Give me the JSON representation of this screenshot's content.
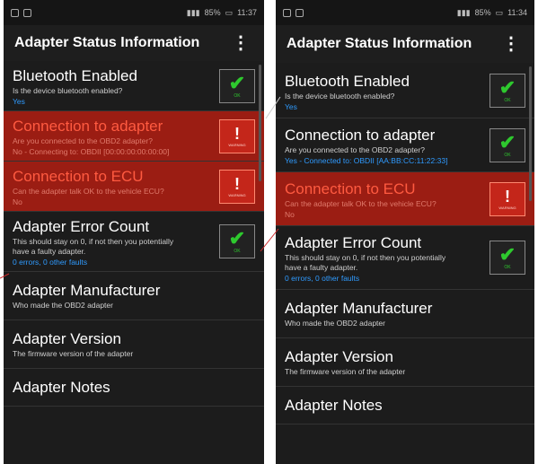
{
  "left": {
    "status_time": "11:37",
    "status_battery": "85%",
    "app_title": "Adapter Status Information",
    "menu_icon": "⋮",
    "items": [
      {
        "title": "Bluetooth Enabled",
        "desc": "Is the device bluetooth enabled?",
        "value": "Yes",
        "state": "ok"
      },
      {
        "title": "Connection to adapter",
        "desc": "Are you connected to the OBD2 adapter?",
        "value": "No - Connecting to: OBDII [00:00:00:00:00:00]",
        "state": "warn"
      },
      {
        "title": "Connection to ECU",
        "desc": "Can the adapter talk OK to the vehicle ECU?",
        "value": "No",
        "state": "warn"
      },
      {
        "title": "Adapter Error Count",
        "desc": "This should stay on 0, if not then you potentially have a faulty adapter.",
        "value": "0 errors, 0 other faults",
        "state": "ok"
      },
      {
        "title": "Adapter Manufacturer",
        "desc": "Who made the OBD2 adapter",
        "value": "",
        "state": "none"
      },
      {
        "title": "Adapter Version",
        "desc": "The firmware version of the adapter",
        "value": "",
        "state": "none"
      },
      {
        "title": "Adapter Notes",
        "desc": "",
        "value": "",
        "state": "none"
      }
    ]
  },
  "right": {
    "status_time": "11:34",
    "status_battery": "85%",
    "app_title": "Adapter Status Information",
    "menu_icon": "⋮",
    "items": [
      {
        "title": "Bluetooth Enabled",
        "desc": "Is the device bluetooth enabled?",
        "value": "Yes",
        "state": "ok"
      },
      {
        "title": "Connection to adapter",
        "desc": "Are you connected to the OBD2 adapter?",
        "value": "Yes - Connected to: OBDII [AA:BB:CC:11:22:33]",
        "state": "ok"
      },
      {
        "title": "Connection to ECU",
        "desc": "Can the adapter talk OK to the vehicle ECU?",
        "value": "No",
        "state": "warn"
      },
      {
        "title": "Adapter Error Count",
        "desc": "This should stay on 0, if not then you potentially have a faulty adapter.",
        "value": "0 errors, 0 other faults",
        "state": "ok"
      },
      {
        "title": "Adapter Manufacturer",
        "desc": "Who made the OBD2 adapter",
        "value": "",
        "state": "none"
      },
      {
        "title": "Adapter Version",
        "desc": "The firmware version of the adapter",
        "value": "",
        "state": "none"
      },
      {
        "title": "Adapter Notes",
        "desc": "",
        "value": "",
        "state": "none"
      }
    ]
  },
  "badges": {
    "ok_mark": "✔",
    "ok_label": "OK",
    "alert_mark": "!",
    "alert_label": "WARNING",
    "ok_color": "#2ec92e",
    "alert_color": "#c4261a"
  },
  "colors": {
    "warning_row": "#9b1d13",
    "value_blue": "#2f9bff",
    "background": "#1c1c1c"
  },
  "icons": [
    "menu-overflow-icon",
    "check-icon",
    "warning-icon",
    "battery-icon",
    "signal-icon",
    "wifi-icon"
  ]
}
